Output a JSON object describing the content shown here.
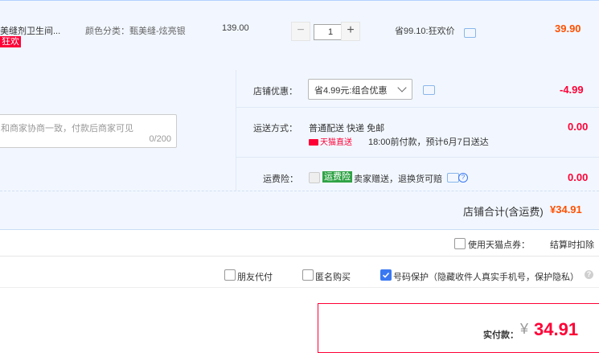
{
  "item": {
    "title": "美缝剂卫生间...",
    "attr": "颜色分类：甄美缝-炫亮银",
    "tag": "狂欢",
    "price": "139.00",
    "quantity": "1",
    "minus": "−",
    "plus": "+",
    "saving": "省99.10:狂欢价",
    "subtotal": "39.90"
  },
  "message": {
    "placeholder": "和商家协商一致，付款后商家可见",
    "counter": "0/200"
  },
  "shop_discount": {
    "label": "店铺优惠：",
    "selected": "省4.99元:组合优惠",
    "amount": "-4.99"
  },
  "shipping": {
    "label": "运送方式：",
    "method": "普通配送 快递 免邮",
    "tmall_express": "天猫直送",
    "note": "18:00前付款，预计6月7日送达",
    "amount": "0.00"
  },
  "insurance": {
    "label": "运费险：",
    "tag": "运费险",
    "text": "卖家赠送，退换货可赔",
    "help": "?",
    "amount": "0.00"
  },
  "shop_total": {
    "label": "店铺合计(含运费)",
    "amount": "¥34.91"
  },
  "points": {
    "label": "使用天猫点券：",
    "note": "结算时扣除"
  },
  "options": {
    "friend_pay": "朋友代付",
    "anonymous": "匿名购买",
    "privacy": "号码保护（隐藏收件人真实手机号，保护隐私）",
    "help": "?"
  },
  "payment": {
    "label": "实付款：",
    "yen": "¥",
    "amount": "34.91"
  },
  "colors": {
    "accent_red": "#ff0036",
    "orange": "#ff5000",
    "blue": "#3a78f2",
    "section_bg": "#f2f7ff"
  }
}
